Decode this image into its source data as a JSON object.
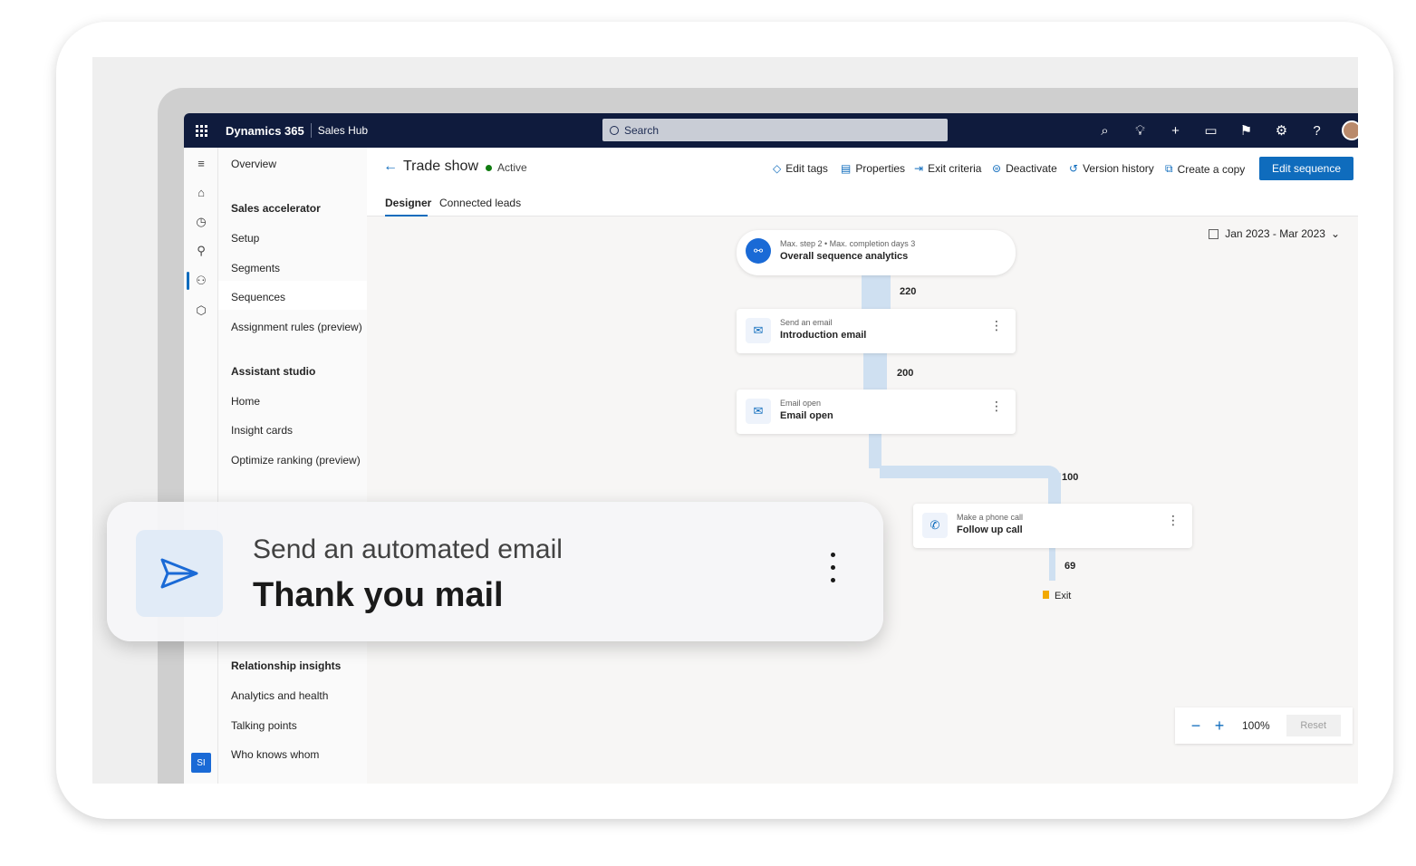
{
  "topbar": {
    "app_name": "Dynamics 365",
    "hub_name": "Sales Hub",
    "search_placeholder": "Search",
    "icons": [
      "search-icon",
      "lightbulb-icon",
      "plus-icon",
      "chat-icon",
      "assistant-icon",
      "settings-icon",
      "help-icon",
      "avatar"
    ]
  },
  "nav": {
    "overview": "Overview",
    "sales_accelerator": "Sales accelerator",
    "setup": "Setup",
    "segments": "Segments",
    "sequences": "Sequences",
    "assignment_rules": "Assignment rules (preview)",
    "assistant_studio": "Assistant studio",
    "home": "Home",
    "insight_cards": "Insight cards",
    "optimize_ranking": "Optimize ranking (preview)",
    "relationship_insights": "Relationship insights",
    "analytics_health": "Analytics and health",
    "talking_points": "Talking points",
    "who_knows_whom": "Who knows whom",
    "user_initials": "SI"
  },
  "record": {
    "title": "Trade show",
    "status": "Active"
  },
  "commands": {
    "edit_tags": "Edit tags",
    "properties": "Properties",
    "exit_criteria": "Exit criteria",
    "deactivate": "Deactivate",
    "version_history": "Version history",
    "create_copy": "Create a copy",
    "edit_sequence": "Edit sequence"
  },
  "tabs": {
    "designer": "Designer",
    "connected_leads": "Connected leads"
  },
  "canvas": {
    "date_range": "Jan 2023 - Mar 2023",
    "analytics": {
      "subtitle": "Max. step 2 • Max. completion days 3",
      "title": "Overall sequence analytics"
    },
    "steps": [
      {
        "subtitle": "Send an email",
        "title": "Introduction email"
      },
      {
        "subtitle": "Email open",
        "title": "Email open"
      },
      {
        "subtitle": "Make a phone call",
        "title": "Follow up call"
      }
    ],
    "counts": {
      "c1": "220",
      "c2": "200",
      "c3": "100",
      "c4": "69"
    },
    "exit_label": "Exit",
    "zoom_level": "100%",
    "reset_label": "Reset"
  },
  "floating_card": {
    "subtitle": "Send an automated email",
    "title": "Thank you mail"
  }
}
